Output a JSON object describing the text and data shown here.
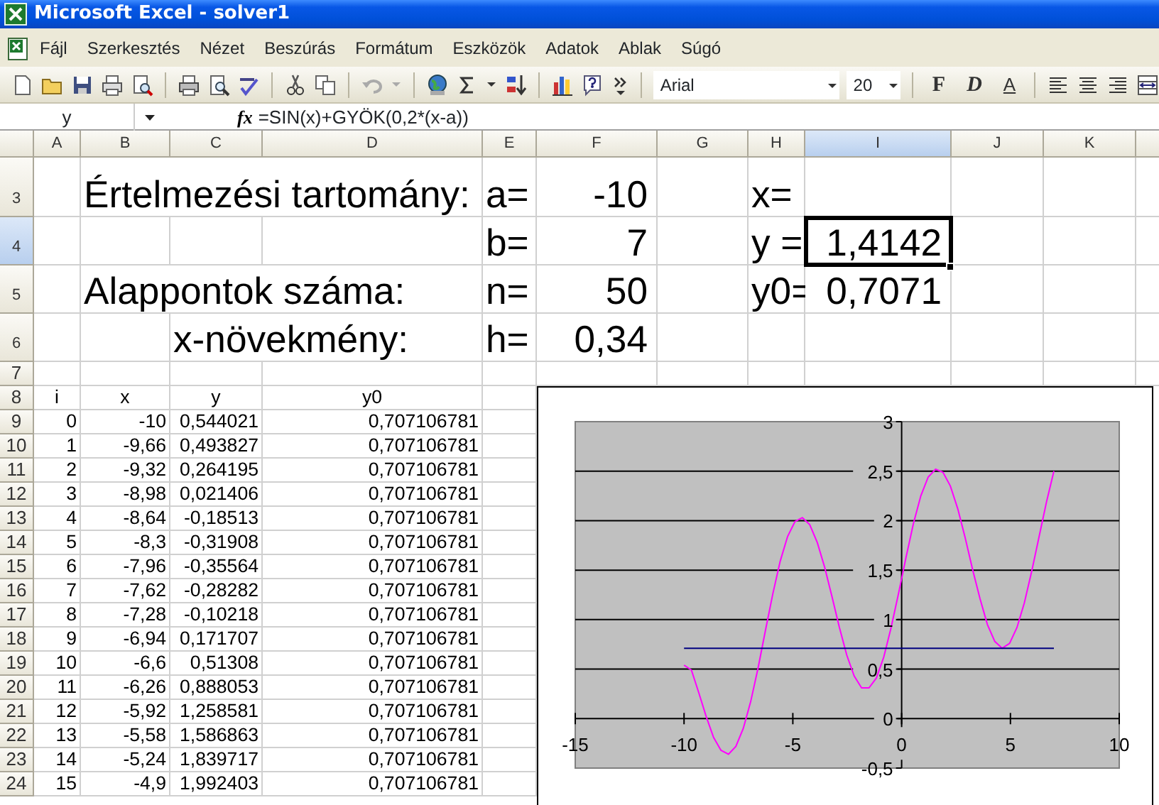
{
  "window": {
    "title": "Microsoft Excel - solver1"
  },
  "menu": {
    "items": [
      "Fájl",
      "Szerkesztés",
      "Nézet",
      "Beszúrás",
      "Formátum",
      "Eszközök",
      "Adatok",
      "Ablak",
      "Súgó"
    ]
  },
  "toolbar": {
    "font": "Arial",
    "font_size": "20",
    "format_buttons": [
      "F",
      "D",
      "A"
    ]
  },
  "formula_bar": {
    "name_box": "y",
    "function_button": "fx",
    "formula": "=SIN(x)+GYÖK(0,2*(x-a))"
  },
  "sheet": {
    "columns": [
      {
        "label": "A",
        "selected": false
      },
      {
        "label": "B",
        "selected": false
      },
      {
        "label": "C",
        "selected": false
      },
      {
        "label": "D",
        "selected": false
      },
      {
        "label": "E",
        "selected": false
      },
      {
        "label": "F",
        "selected": false
      },
      {
        "label": "G",
        "selected": false
      },
      {
        "label": "H",
        "selected": false
      },
      {
        "label": "I",
        "selected": true
      },
      {
        "label": "J",
        "selected": false
      },
      {
        "label": "K",
        "selected": false
      }
    ],
    "rows": [
      {
        "number": "3",
        "selected": false,
        "kind": "label",
        "cells": [
          null,
          "Értelmezési tartomány:",
          null,
          null,
          "a=",
          "-10",
          null,
          "x=",
          null,
          null,
          null
        ]
      },
      {
        "number": "4",
        "selected": true,
        "kind": "label",
        "cells": [
          null,
          null,
          null,
          null,
          "b=",
          "7",
          null,
          "y =",
          "1,4142",
          null,
          null
        ]
      },
      {
        "number": "5",
        "selected": false,
        "kind": "label",
        "cells": [
          null,
          "Alappontok száma:",
          null,
          null,
          "n=",
          "50",
          null,
          "y0=",
          "0,7071",
          null,
          null
        ]
      },
      {
        "number": "6",
        "selected": false,
        "kind": "label",
        "cells": [
          null,
          null,
          "x-növekmény:",
          null,
          "h=",
          "0,34",
          null,
          null,
          null,
          null,
          null
        ]
      },
      {
        "number": "7",
        "selected": false,
        "kind": "data",
        "cells": [
          null,
          null,
          null,
          null,
          null,
          null,
          null,
          null,
          null,
          null,
          null
        ]
      },
      {
        "number": "8",
        "selected": false,
        "kind": "header",
        "cells": [
          "i",
          "x",
          "y",
          "y0",
          null,
          null,
          null,
          null,
          null,
          null,
          null
        ]
      },
      {
        "number": "9",
        "selected": false,
        "kind": "data",
        "cells": [
          "0",
          "-10",
          "0,544021",
          "0,707106781",
          null,
          null,
          null,
          null,
          null,
          null,
          null
        ]
      },
      {
        "number": "10",
        "selected": false,
        "kind": "data",
        "cells": [
          "1",
          "-9,66",
          "0,493827",
          "0,707106781",
          null,
          null,
          null,
          null,
          null,
          null,
          null
        ]
      },
      {
        "number": "11",
        "selected": false,
        "kind": "data",
        "cells": [
          "2",
          "-9,32",
          "0,264195",
          "0,707106781",
          null,
          null,
          null,
          null,
          null,
          null,
          null
        ]
      },
      {
        "number": "12",
        "selected": false,
        "kind": "data",
        "cells": [
          "3",
          "-8,98",
          "0,021406",
          "0,707106781",
          null,
          null,
          null,
          null,
          null,
          null,
          null
        ]
      },
      {
        "number": "13",
        "selected": false,
        "kind": "data",
        "cells": [
          "4",
          "-8,64",
          "-0,18513",
          "0,707106781",
          null,
          null,
          null,
          null,
          null,
          null,
          null
        ]
      },
      {
        "number": "14",
        "selected": false,
        "kind": "data",
        "cells": [
          "5",
          "-8,3",
          "-0,31908",
          "0,707106781",
          null,
          null,
          null,
          null,
          null,
          null,
          null
        ]
      },
      {
        "number": "15",
        "selected": false,
        "kind": "data",
        "cells": [
          "6",
          "-7,96",
          "-0,35564",
          "0,707106781",
          null,
          null,
          null,
          null,
          null,
          null,
          null
        ]
      },
      {
        "number": "16",
        "selected": false,
        "kind": "data",
        "cells": [
          "7",
          "-7,62",
          "-0,28282",
          "0,707106781",
          null,
          null,
          null,
          null,
          null,
          null,
          null
        ]
      },
      {
        "number": "17",
        "selected": false,
        "kind": "data",
        "cells": [
          "8",
          "-7,28",
          "-0,10218",
          "0,707106781",
          null,
          null,
          null,
          null,
          null,
          null,
          null
        ]
      },
      {
        "number": "18",
        "selected": false,
        "kind": "data",
        "cells": [
          "9",
          "-6,94",
          "0,171707",
          "0,707106781",
          null,
          null,
          null,
          null,
          null,
          null,
          null
        ]
      },
      {
        "number": "19",
        "selected": false,
        "kind": "data",
        "cells": [
          "10",
          "-6,6",
          "0,51308",
          "0,707106781",
          null,
          null,
          null,
          null,
          null,
          null,
          null
        ]
      },
      {
        "number": "20",
        "selected": false,
        "kind": "data",
        "cells": [
          "11",
          "-6,26",
          "0,888053",
          "0,707106781",
          null,
          null,
          null,
          null,
          null,
          null,
          null
        ]
      },
      {
        "number": "21",
        "selected": false,
        "kind": "data",
        "cells": [
          "12",
          "-5,92",
          "1,258581",
          "0,707106781",
          null,
          null,
          null,
          null,
          null,
          null,
          null
        ]
      },
      {
        "number": "22",
        "selected": false,
        "kind": "data",
        "cells": [
          "13",
          "-5,58",
          "1,586863",
          "0,707106781",
          null,
          null,
          null,
          null,
          null,
          null,
          null
        ]
      },
      {
        "number": "23",
        "selected": false,
        "kind": "data",
        "cells": [
          "14",
          "-5,24",
          "1,839717",
          "0,707106781",
          null,
          null,
          null,
          null,
          null,
          null,
          null
        ]
      },
      {
        "number": "24",
        "selected": false,
        "kind": "data",
        "cells": [
          "15",
          "-4,9",
          "1,992403",
          "0,707106781",
          null,
          null,
          null,
          null,
          null,
          null,
          null
        ]
      }
    ],
    "chart": {
      "chart_data": {
        "type": "line",
        "grid": true,
        "x": [
          -10,
          -9.66,
          -9.32,
          -8.98,
          -8.64,
          -8.3,
          -7.96,
          -7.62,
          -7.28,
          -6.94,
          -6.6,
          -6.26,
          -5.92,
          -5.58,
          -5.24,
          -4.9,
          -4.56,
          -4.22,
          -3.88,
          -3.54,
          -3.2,
          -2.86,
          -2.52,
          -2.18,
          -1.84,
          -1.5,
          -1.16,
          -0.82,
          -0.48,
          -0.14,
          0.2,
          0.54,
          0.88,
          1.22,
          1.56,
          1.9,
          2.24,
          2.58,
          2.92,
          3.26,
          3.6,
          3.94,
          4.28,
          4.62,
          4.96,
          5.3,
          5.64,
          5.98,
          6.32,
          6.66,
          7
        ],
        "series": [
          {
            "color": "#ff00ff",
            "values": [
              0.54,
              0.49,
              0.26,
              0.02,
              -0.19,
              -0.32,
              -0.36,
              -0.28,
              -0.1,
              0.17,
              0.51,
              0.89,
              1.26,
              1.59,
              1.84,
              1.99,
              2.03,
              1.96,
              1.78,
              1.53,
              1.23,
              0.92,
              0.64,
              0.43,
              0.31,
              0.31,
              0.41,
              0.62,
              0.92,
              1.27,
              1.63,
              1.97,
              2.25,
              2.44,
              2.52,
              2.49,
              2.35,
              2.12,
              1.83,
              1.51,
              1.21,
              0.95,
              0.78,
              0.71,
              0.76,
              0.92,
              1.17,
              1.49,
              1.84,
              2.19,
              2.5
            ]
          },
          {
            "color": "#000080",
            "values": [
              0.71,
              0.71,
              0.71,
              0.71,
              0.71,
              0.71,
              0.71,
              0.71,
              0.71,
              0.71,
              0.71,
              0.71,
              0.71,
              0.71,
              0.71,
              0.71,
              0.71,
              0.71,
              0.71,
              0.71,
              0.71,
              0.71,
              0.71,
              0.71,
              0.71,
              0.71,
              0.71,
              0.71,
              0.71,
              0.71,
              0.71,
              0.71,
              0.71,
              0.71,
              0.71,
              0.71,
              0.71,
              0.71,
              0.71,
              0.71,
              0.71,
              0.71,
              0.71,
              0.71,
              0.71,
              0.71,
              0.71,
              0.71,
              0.71,
              0.71,
              0.71
            ]
          }
        ],
        "xlim": [
          -15,
          10
        ],
        "ylim": [
          -0.5,
          3
        ],
        "xticks": [
          -15,
          -10,
          -5,
          0,
          5,
          10
        ],
        "yticks": [
          {
            "value": -0.5,
            "label": "-0,5"
          },
          {
            "value": 0,
            "label": "0"
          },
          {
            "value": 0.5,
            "label": "0,5"
          },
          {
            "value": 1,
            "label": "1"
          },
          {
            "value": 1.5,
            "label": "1,5"
          },
          {
            "value": 2,
            "label": "2"
          },
          {
            "value": 2.5,
            "label": "2,5"
          },
          {
            "value": 3,
            "label": "3"
          }
        ]
      }
    }
  }
}
